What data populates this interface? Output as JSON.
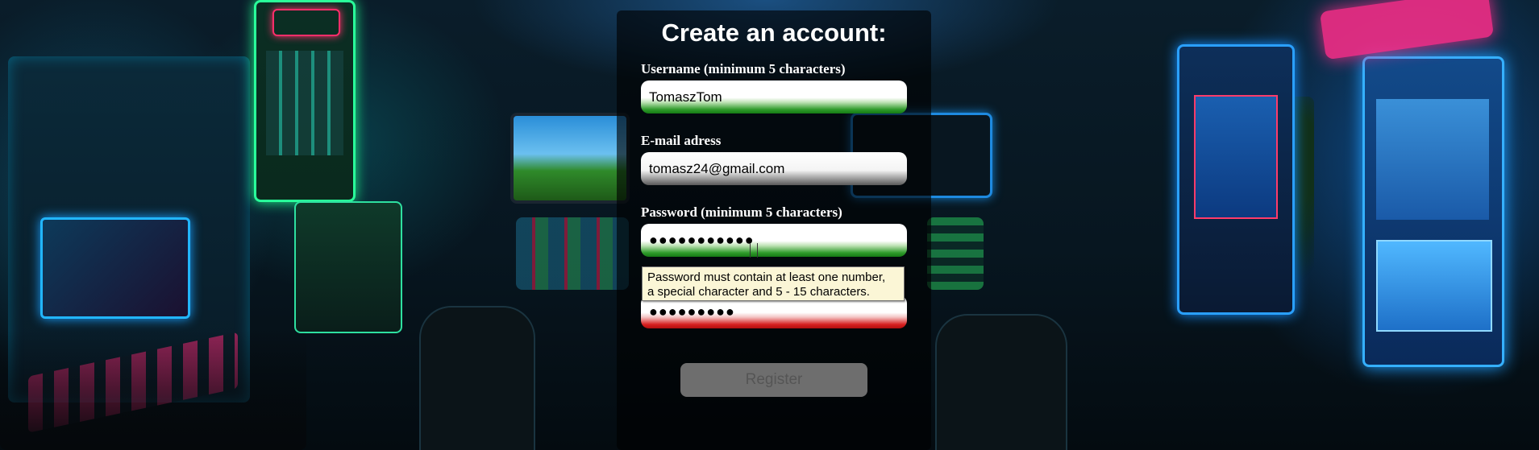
{
  "form": {
    "title": "Create an account:",
    "username": {
      "label": "Username (minimum 5 characters)",
      "value": "TomaszTom",
      "state": "valid"
    },
    "email": {
      "label": "E-mail adress",
      "value": "tomasz24@gmail.com",
      "state": "neutral"
    },
    "password": {
      "label": "Password (minimum 5 characters)",
      "value": "●●●●●●●●●●●",
      "state": "valid"
    },
    "password_confirm": {
      "value": "●●●●●●●●●",
      "state": "invalid"
    },
    "tooltip": {
      "line1": "Password must contain at least one number,",
      "line2": "a special character and 5 - 15 characters."
    },
    "register_label": "Register"
  },
  "colors": {
    "valid": "#2e9a2a",
    "invalid": "#d82020",
    "panel": "rgba(0,0,0,0.62)"
  }
}
